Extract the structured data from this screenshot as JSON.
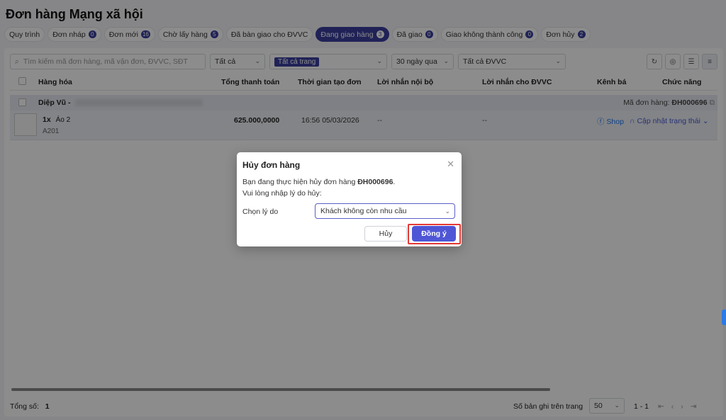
{
  "page_title": "Đơn hàng Mạng xã hội",
  "tabs": [
    {
      "label": "Quy trình",
      "count": ""
    },
    {
      "label": "Đơn nháp",
      "count": "0"
    },
    {
      "label": "Đơn mới",
      "count": "16"
    },
    {
      "label": "Chờ lấy hàng",
      "count": "5"
    },
    {
      "label": "Đã bàn giao cho ĐVVC",
      "count": ""
    },
    {
      "label": "Đang giao hàng",
      "count": "3"
    },
    {
      "label": "Đã giao",
      "count": "0"
    },
    {
      "label": "Giao không thành công",
      "count": "0"
    },
    {
      "label": "Đơn hủy",
      "count": "2"
    }
  ],
  "toolbar": {
    "search_placeholder": "Tìm kiếm mã đơn hàng, mã vận đơn, ĐVVC, SĐT",
    "filter_all": "Tất cả",
    "store_filter": "Tất cả trang",
    "period": "30 ngày qua",
    "carrier": "Tất cả ĐVVC"
  },
  "columns": {
    "product": "Hàng hóa",
    "total": "Tổng thanh toán",
    "created": "Thời gian tạo đơn",
    "internal_note": "Lời nhắn nội bộ",
    "carrier_note": "Lời nhắn cho ĐVVC",
    "channel": "Kênh bá",
    "actions": "Chức năng"
  },
  "order": {
    "customer": "Diệp Vũ -",
    "order_code_label": "Mã đơn hàng:",
    "order_code": "ĐH000696",
    "qty": "1x",
    "product_name": "Áo 2",
    "sku": "A201",
    "total": "625.000,0000",
    "created": "16:56 05/03/2026",
    "internal_note": "--",
    "carrier_note": "--",
    "channel": "Shop",
    "action": "Cập nhật trạng thái"
  },
  "footer": {
    "total_label": "Tổng số:",
    "total_value": "1",
    "per_page_label": "Số bản ghi trên trang",
    "per_page": "50",
    "range": "1 - 1"
  },
  "modal": {
    "title": "Hủy đơn hàng",
    "line1_prefix": "Bạn đang thực hiện hủy đơn hàng ",
    "line1_code": "ĐH000696",
    "line1_suffix": ".",
    "line2": "Vui lòng nhập lý do hủy:",
    "reason_label": "Chọn lý do",
    "reason_value": "Khách không còn nhu cầu",
    "cancel_label": "Hủy",
    "confirm_label": "Đồng ý"
  },
  "colors": {
    "primary": "#3b3f9e",
    "confirm_button": "#4f56d6",
    "highlight_border": "#e53935"
  }
}
